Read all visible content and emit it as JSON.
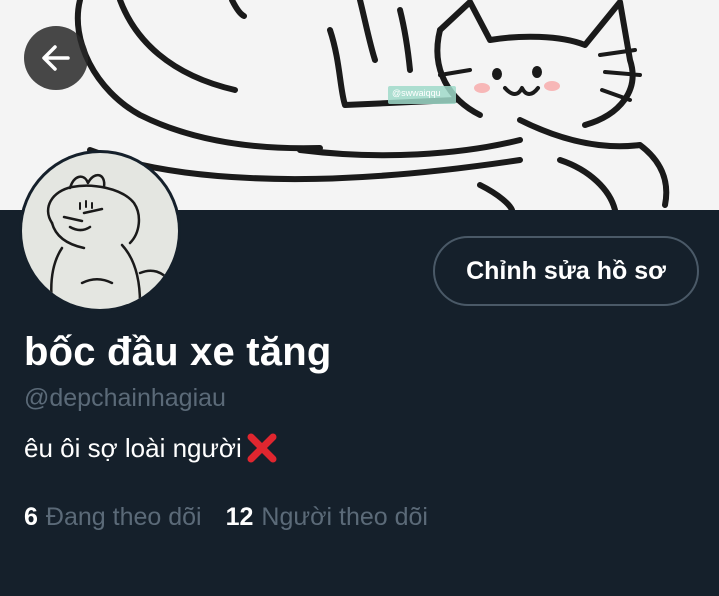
{
  "header": {
    "banner_watermark": "@swwaiqqu"
  },
  "back_button": {
    "icon": "arrow-left-icon"
  },
  "profile": {
    "edit_button_label": "Chỉnh sửa hồ sơ",
    "display_name": "bốc đầu xe tăng",
    "handle": "@depchainhagiau",
    "bio_text": "êu ôi sợ loài người",
    "bio_emoji_icon": "cross-mark-icon"
  },
  "stats": {
    "following_count": "6",
    "following_label": "Đang theo dõi",
    "followers_count": "12",
    "followers_label": "Người theo dõi"
  },
  "colors": {
    "background": "#15202b",
    "muted_text": "#5b6a78",
    "button_border": "#4a5967",
    "emoji_red": "#e0262f"
  }
}
